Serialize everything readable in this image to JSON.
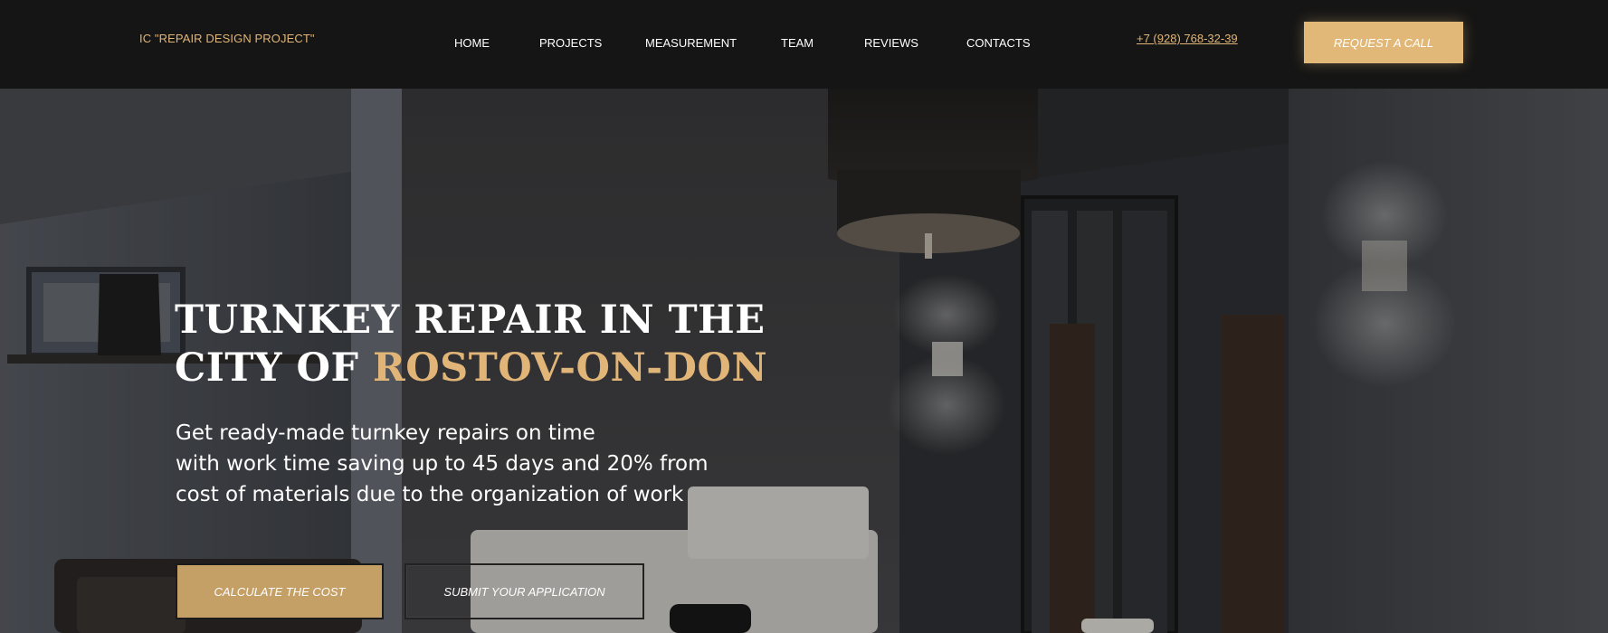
{
  "header": {
    "logo": "IC \"REPAIR DESIGN PROJECT\"",
    "nav": [
      {
        "label": "HOME"
      },
      {
        "label": "PROJECTS"
      },
      {
        "label": "MEASUREMENT"
      },
      {
        "label": "TEAM"
      },
      {
        "label": "REVIEWS"
      },
      {
        "label": "CONTACTS"
      }
    ],
    "phone": "+7 (928) 768-32-39",
    "call_button": "REQUEST A CALL"
  },
  "hero": {
    "title_line1": "TURNKEY REPAIR IN THE",
    "title_line2_prefix": "CITY OF ",
    "title_line2_accent": "ROSTOV-ON-DON",
    "subtitle_lines": [
      "Get ready-made turnkey repairs on time",
      "with work time saving up to 45 days and 20% from",
      "cost of materials due to the organization of work"
    ],
    "primary_button": "CALCULATE THE COST",
    "secondary_button": "SUBMIT YOUR APPLICATION"
  },
  "colors": {
    "accent": "#e0b577",
    "header_bg": "#151515",
    "primary_button_bg": "#c49f66"
  }
}
